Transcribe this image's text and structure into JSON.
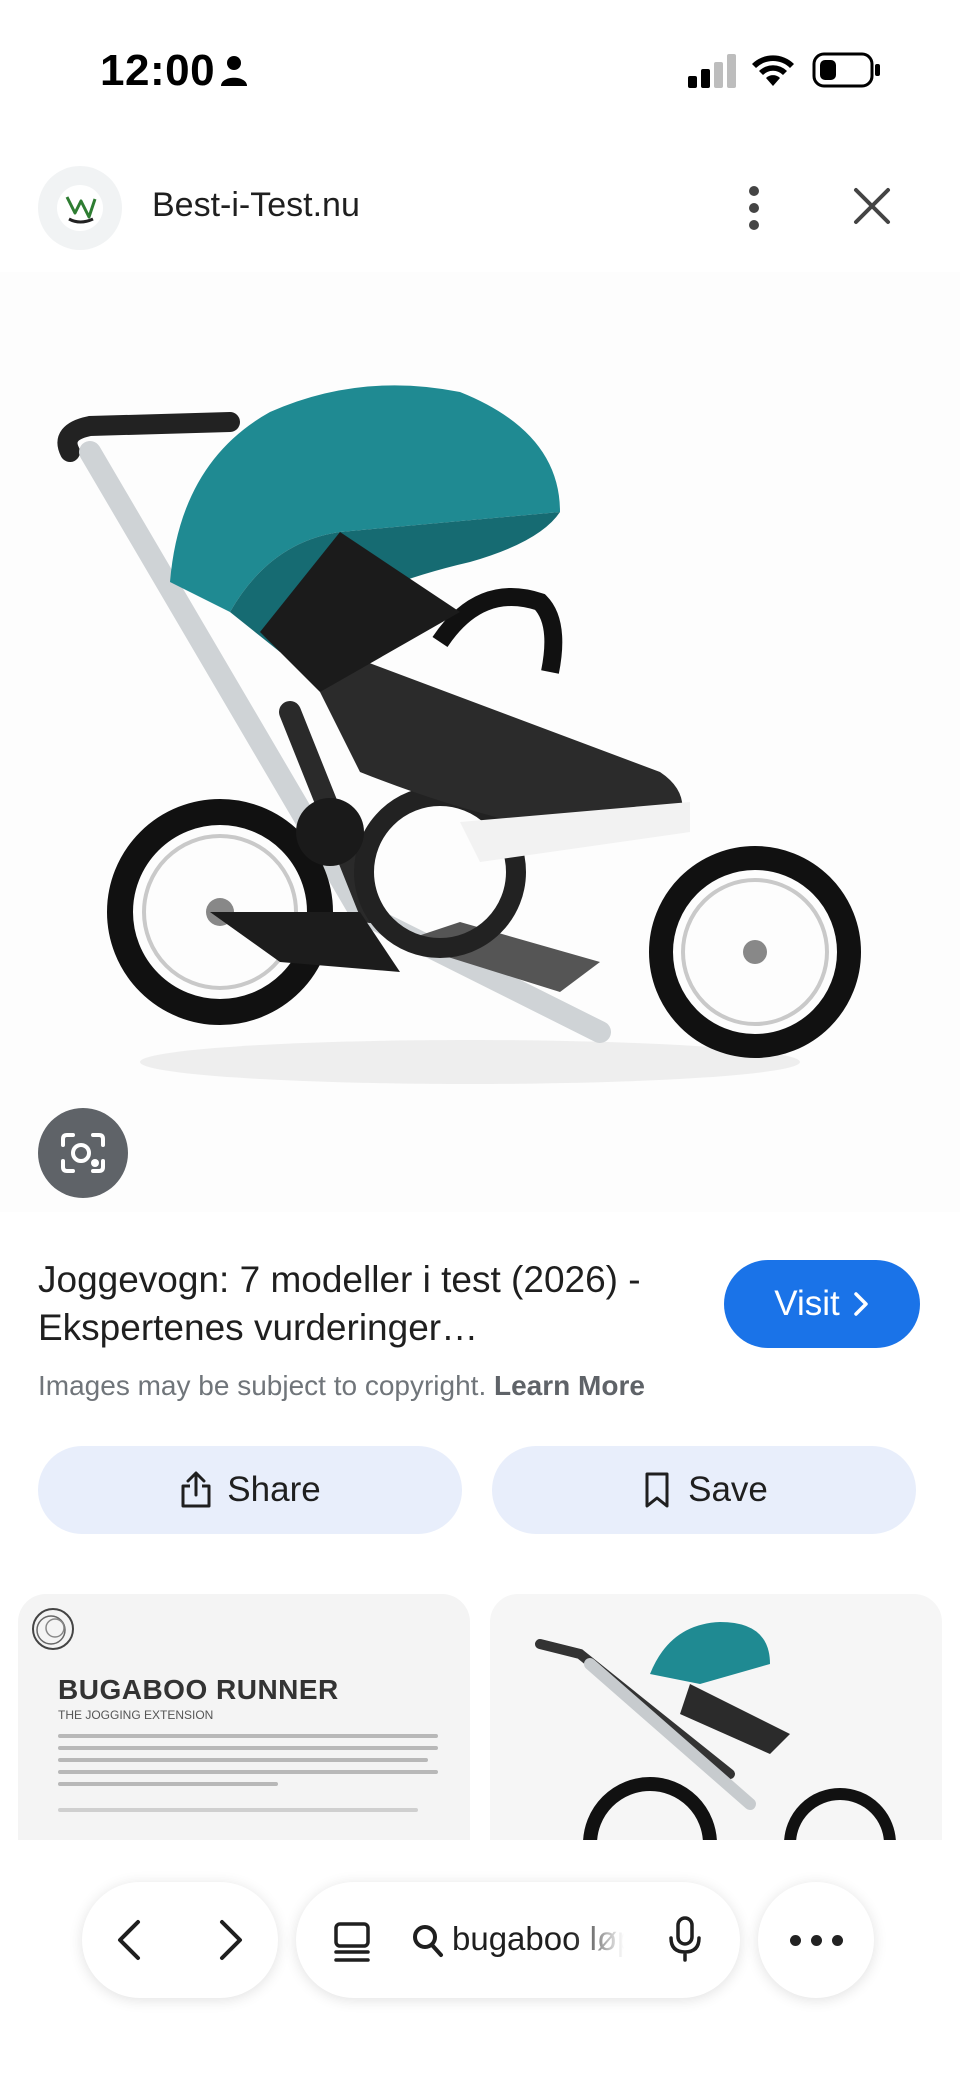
{
  "status_bar": {
    "time": "12:00"
  },
  "header": {
    "site_name": "Best-i-Test.nu"
  },
  "result": {
    "title": "Joggevogn: 7 modeller i test (2026) - Ekspertenes vurderinger…",
    "visit_label": "Visit",
    "copyright_text": "Images may be subject to copyright.",
    "learn_more_label": "Learn More"
  },
  "actions": {
    "share_label": "Share",
    "save_label": "Save"
  },
  "related": {
    "thumb1_heading": "BUGABOO RUNNER",
    "thumb1_sub": "THE JOGGING EXTENSION"
  },
  "toolbar": {
    "search_query": "bugaboo løpe"
  },
  "colors": {
    "accent": "#1a73e8",
    "action_bg": "#e8eefb",
    "canopy": "#1f8a92"
  }
}
